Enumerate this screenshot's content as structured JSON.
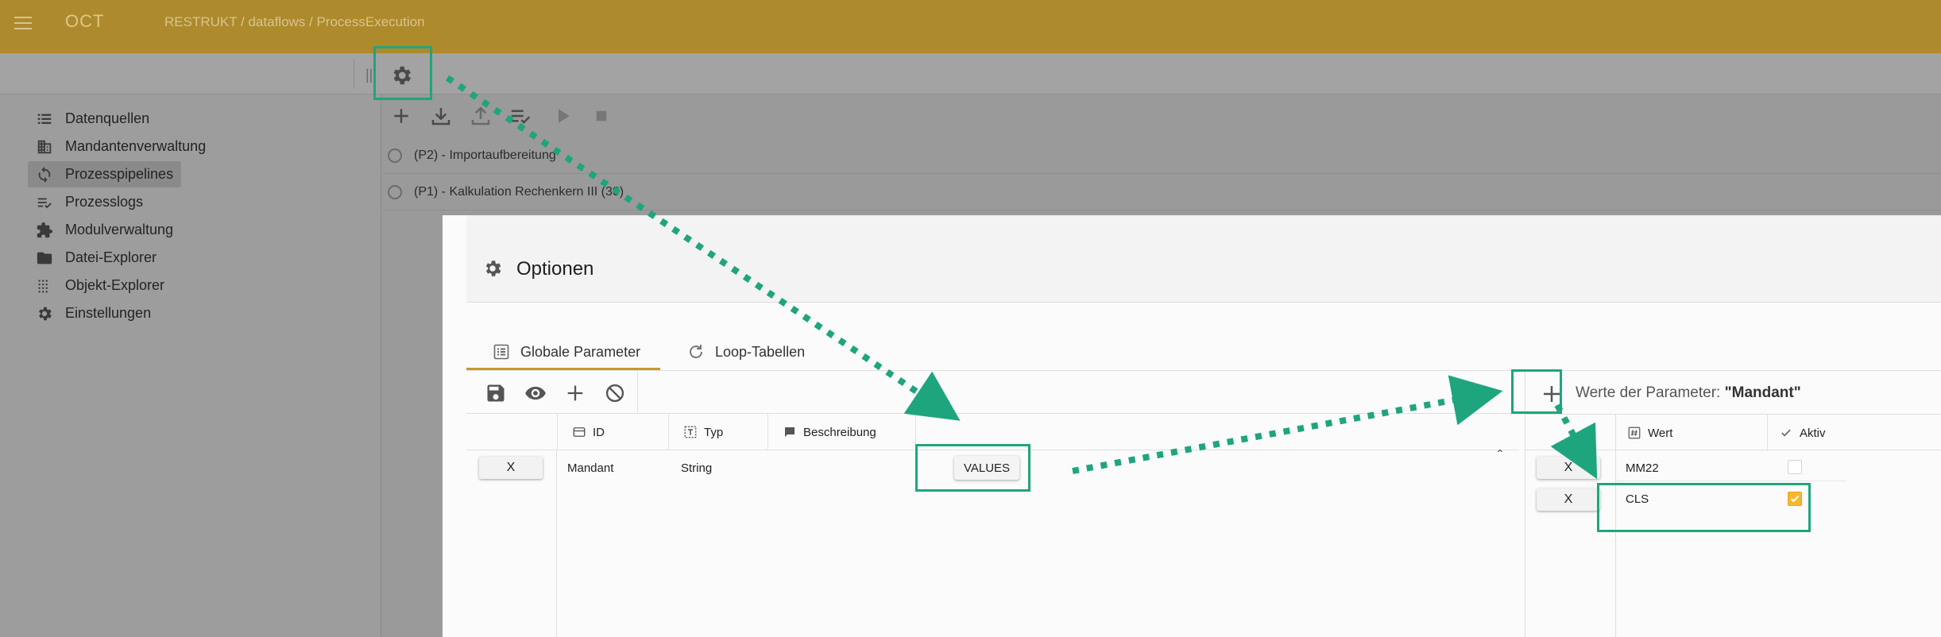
{
  "app": {
    "title": "OCT",
    "breadcrumb": "RESTRUKT / dataflows / ProcessExecution"
  },
  "sidebar": {
    "items": [
      {
        "label": "Datenquellen",
        "icon": "list-icon"
      },
      {
        "label": "Mandantenverwaltung",
        "icon": "building-icon"
      },
      {
        "label": "Prozesspipelines",
        "icon": "sync-icon",
        "active": true
      },
      {
        "label": "Prozesslogs",
        "icon": "log-list-icon"
      },
      {
        "label": "Modulverwaltung",
        "icon": "puzzle-icon"
      },
      {
        "label": "Datei-Explorer",
        "icon": "folder-icon"
      },
      {
        "label": "Objekt-Explorer",
        "icon": "grid-dots-icon"
      },
      {
        "label": "Einstellungen",
        "icon": "gear-icon"
      }
    ]
  },
  "pipelines": {
    "rows": [
      {
        "label": "(P2) - Importaufbereitung"
      },
      {
        "label": "(P1) - Kalkulation Rechenkern III (30)"
      }
    ]
  },
  "dialog": {
    "title": "Optionen",
    "tabs": [
      {
        "label": "Globale Parameter",
        "icon": "list-box-icon",
        "active": true
      },
      {
        "label": "Loop-Tabellen",
        "icon": "refresh-icon"
      }
    ],
    "columns": {
      "id": "ID",
      "type": "Typ",
      "description": "Beschreibung"
    },
    "rows": [
      {
        "delete": "X",
        "id": "Mandant",
        "type": "String",
        "description": "",
        "values_button": "VALUES"
      }
    ],
    "values_panel": {
      "title_prefix": "Werte der Parameter: ",
      "title_param": "\"Mandant\"",
      "columns": {
        "value": "Wert",
        "active": "Aktiv"
      },
      "rows": [
        {
          "delete": "X",
          "value": "MM22",
          "active": false
        },
        {
          "delete": "X",
          "value": "CLS",
          "active": true
        }
      ]
    }
  },
  "colors": {
    "appbar": "#ad8a2b",
    "highlight": "#1fa57e",
    "accent": "#f6b72d",
    "tab_underline": "#c79a2c"
  }
}
